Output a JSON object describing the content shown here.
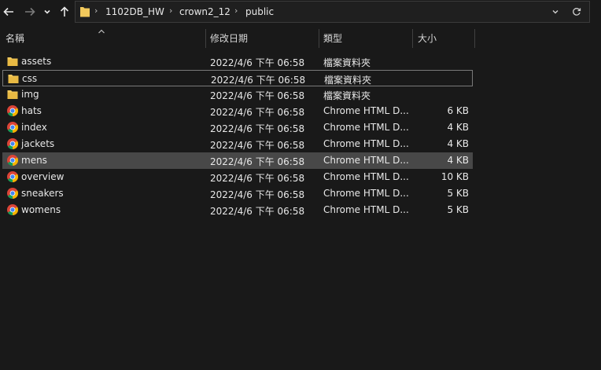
{
  "nav": {
    "breadcrumbs": [
      "1102DB_HW",
      "crown2_12",
      "public"
    ]
  },
  "columns": {
    "name": "名稱",
    "date": "修改日期",
    "type": "類型",
    "size": "大小"
  },
  "files": [
    {
      "name": "assets",
      "date": "2022/4/6 下午 06:58",
      "type": "檔案資料夾",
      "size": "",
      "icon": "folder-icon"
    },
    {
      "name": "css",
      "date": "2022/4/6 下午 06:58",
      "type": "檔案資料夾",
      "size": "",
      "icon": "folder-icon"
    },
    {
      "name": "img",
      "date": "2022/4/6 下午 06:58",
      "type": "檔案資料夾",
      "size": "",
      "icon": "folder-icon"
    },
    {
      "name": "hats",
      "date": "2022/4/6 下午 06:58",
      "type": "Chrome HTML D...",
      "size": "6 KB",
      "icon": "chrome-icon"
    },
    {
      "name": "index",
      "date": "2022/4/6 下午 06:58",
      "type": "Chrome HTML D...",
      "size": "4 KB",
      "icon": "chrome-icon"
    },
    {
      "name": "jackets",
      "date": "2022/4/6 下午 06:58",
      "type": "Chrome HTML D...",
      "size": "4 KB",
      "icon": "chrome-icon"
    },
    {
      "name": "mens",
      "date": "2022/4/6 下午 06:58",
      "type": "Chrome HTML D...",
      "size": "4 KB",
      "icon": "chrome-icon"
    },
    {
      "name": "overview",
      "date": "2022/4/6 下午 06:58",
      "type": "Chrome HTML D...",
      "size": "10 KB",
      "icon": "chrome-icon"
    },
    {
      "name": "sneakers",
      "date": "2022/4/6 下午 06:58",
      "type": "Chrome HTML D...",
      "size": "5 KB",
      "icon": "chrome-icon"
    },
    {
      "name": "womens",
      "date": "2022/4/6 下午 06:58",
      "type": "Chrome HTML D...",
      "size": "5 KB",
      "icon": "chrome-icon"
    }
  ],
  "colors": {
    "background": "#191919",
    "selected_row": "#484848",
    "folder": "#f2c95c"
  }
}
